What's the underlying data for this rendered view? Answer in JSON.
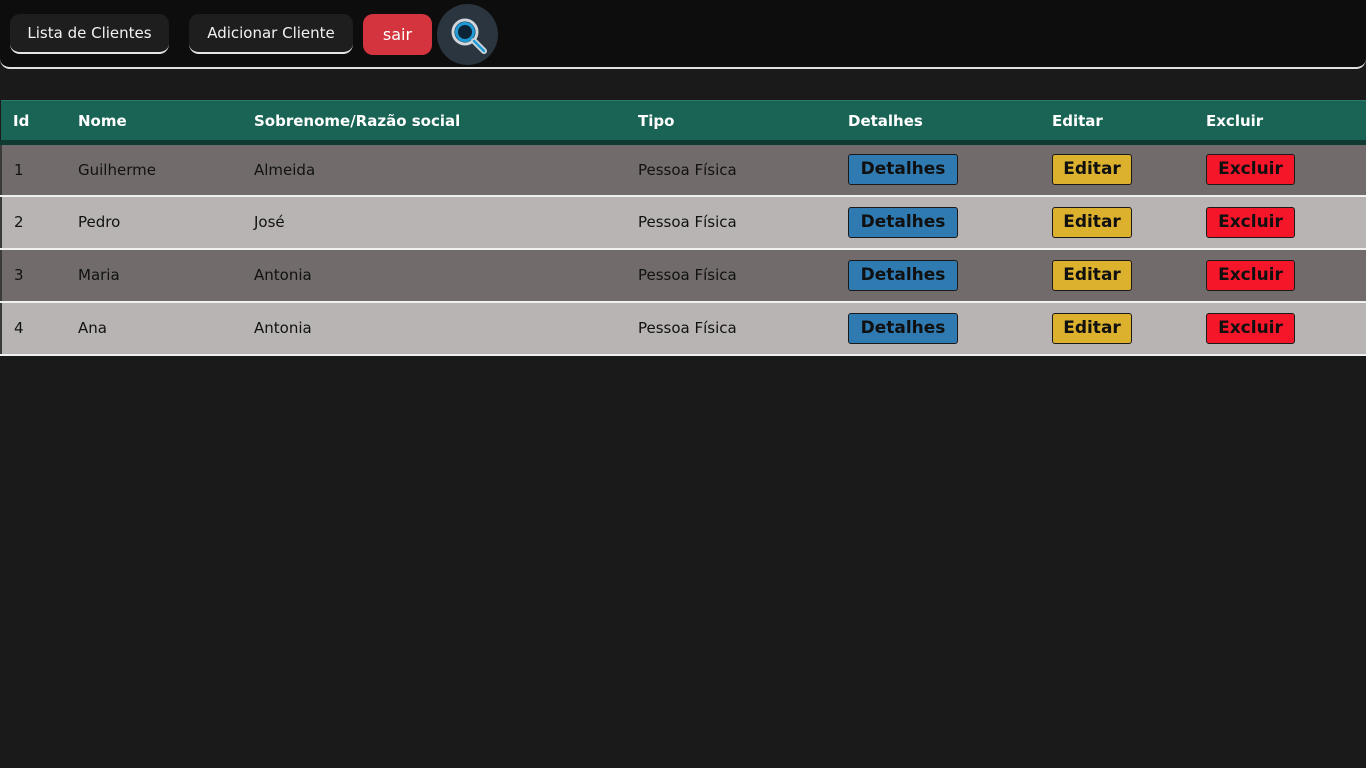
{
  "navbar": {
    "list_label": "Lista de Clientes",
    "add_label": "Adicionar Cliente",
    "logout_label": "sair",
    "search_icon": "search-icon"
  },
  "table": {
    "headers": [
      "Id",
      "Nome",
      "Sobrenome/Razão social",
      "Tipo",
      "Detalhes",
      "Editar",
      "Excluir"
    ],
    "rows": [
      {
        "id": "1",
        "nome": "Guilherme",
        "sobrenome": "Almeida",
        "tipo": "Pessoa Física",
        "details_label": "Detalhes",
        "edit_label": "Editar",
        "delete_label": "Excluir"
      },
      {
        "id": "2",
        "nome": "Pedro",
        "sobrenome": "José",
        "tipo": "Pessoa Física",
        "details_label": "Detalhes",
        "edit_label": "Editar",
        "delete_label": "Excluir"
      },
      {
        "id": "3",
        "nome": "Maria",
        "sobrenome": "Antonia",
        "tipo": "Pessoa Física",
        "details_label": "Detalhes",
        "edit_label": "Editar",
        "delete_label": "Excluir"
      },
      {
        "id": "4",
        "nome": "Ana",
        "sobrenome": "Antonia",
        "tipo": "Pessoa Física",
        "details_label": "Detalhes",
        "edit_label": "Editar",
        "delete_label": "Excluir"
      }
    ]
  },
  "colors": {
    "background": "#1a1a1a",
    "header_bg": "#1a6455",
    "row_dark": "#716c6b",
    "row_light": "#b8b4b3",
    "details_button": "#2f7ab1",
    "edit_button": "#dcb12e",
    "delete_button": "#f5162a",
    "logout_button": "#d3343d"
  }
}
